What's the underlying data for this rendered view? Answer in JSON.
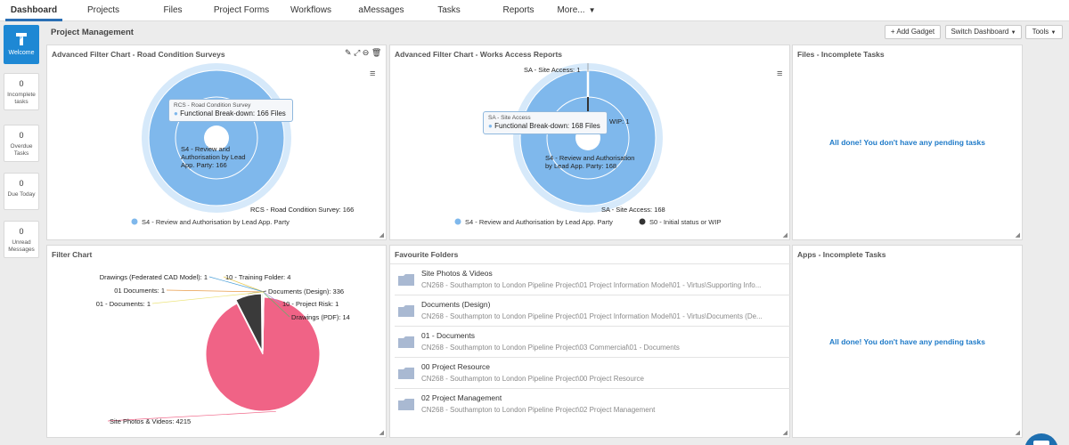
{
  "nav": {
    "items": [
      {
        "label": "Dashboard",
        "active": true
      },
      {
        "label": "Projects"
      },
      {
        "label": "Files"
      },
      {
        "label": "Project Forms"
      },
      {
        "label": "Workflows"
      },
      {
        "label": "aMessages"
      },
      {
        "label": "Tasks"
      },
      {
        "label": "Reports"
      },
      {
        "label": "More..."
      }
    ]
  },
  "sidebar": {
    "welcome_label": "Welcome",
    "cards": [
      {
        "count": "0",
        "label_lines": [
          "Incomplete",
          "tasks"
        ]
      },
      {
        "count": "0",
        "label_lines": [
          "Overdue",
          "Tasks"
        ]
      },
      {
        "count": "0",
        "label_lines": [
          "Due Today"
        ]
      },
      {
        "count": "0",
        "label_lines": [
          "Unread",
          "Messages"
        ]
      }
    ]
  },
  "toolbar": {
    "section_title": "Project Management",
    "add_gadget": "+ Add Gadget",
    "switch_dashboard": "Switch Dashboard",
    "tools": "Tools"
  },
  "panels": {
    "rcs": {
      "title": "Advanced Filter Chart - Road Condition Surveys",
      "tooltip_title": "RCS - Road Condition Survey",
      "tooltip_value": "Functional Break-down: 166 Files",
      "inner_label_lines": [
        "S4 - Review and",
        "Authorisation by Lead",
        "App. Party: 166"
      ],
      "outer_label": "RCS - Road Condition Survey: 166",
      "legend": [
        "S4 - Review and Authorisation by Lead App. Party"
      ]
    },
    "works": {
      "title": "Advanced Filter Chart - Works Access Reports",
      "top_label": "SA - Site Access: 1",
      "tooltip_title": "SA - Site Access",
      "tooltip_value": "Functional Break-down: 168 Files",
      "wip_fragment": "WIP: 1",
      "inner_label_lines": [
        "S4 - Review and Authorisation",
        "by Lead App. Party: 168"
      ],
      "outer_label": "SA - Site Access: 168",
      "legend": [
        "S4 - Review and Authorisation by Lead App. Party",
        "S0 - Initial status or WIP"
      ]
    },
    "files_tasks": {
      "title": "Files - Incomplete Tasks",
      "message": "All done! You don't have any pending tasks"
    },
    "filter": {
      "title": "Filter Chart"
    },
    "favourites": {
      "title": "Favourite Folders",
      "folders": [
        {
          "name": "Site Photos & Videos",
          "path": "CN268 - Southampton to London Pipeline Project\\01 Project Information Model\\01 - Virtus\\Supporting Info..."
        },
        {
          "name": "Documents (Design)",
          "path": "CN268 - Southampton to London Pipeline Project\\01 Project Information Model\\01 - Virtus\\Documents (De..."
        },
        {
          "name": "01 - Documents",
          "path": "CN268 - Southampton to London Pipeline Project\\03 Commercial\\01 - Documents"
        },
        {
          "name": "00 Project Resource",
          "path": "CN268 - Southampton to London Pipeline Project\\00 Project Resource"
        },
        {
          "name": "02 Project Management",
          "path": "CN268 - Southampton to London Pipeline Project\\02 Project Management"
        }
      ]
    },
    "apps_tasks": {
      "title": "Apps - Incomplete Tasks",
      "message": "All done! You don't have any pending tasks"
    }
  },
  "chart_data": [
    {
      "type": "pie",
      "title": "Advanced Filter Chart - Road Condition Surveys",
      "categories": [
        "RCS - Road Condition Survey"
      ],
      "series": [
        {
          "name": "S4 - Review and Authorisation by Lead App. Party",
          "values": [
            166
          ]
        }
      ],
      "colors": [
        "#7fb8ec"
      ]
    },
    {
      "type": "pie",
      "title": "Advanced Filter Chart - Works Access Reports",
      "categories": [
        "SA - Site Access"
      ],
      "series": [
        {
          "name": "S4 - Review and Authorisation by Lead App. Party",
          "values": [
            168
          ]
        },
        {
          "name": "S0 - Initial status or WIP",
          "values": [
            1
          ]
        }
      ],
      "colors": [
        "#7fb8ec",
        "#333333"
      ]
    },
    {
      "type": "pie",
      "title": "Filter Chart",
      "slices": [
        {
          "label": "Site Photos & Videos",
          "value": 4215,
          "color": "#f06386"
        },
        {
          "label": "Documents (Design)",
          "value": 336,
          "color": "#3a3a3a"
        },
        {
          "label": "Drawings (PDF)",
          "value": 14,
          "color": "#5fb36b"
        },
        {
          "label": "10 - Project Risk",
          "value": 1,
          "color": "#a78bd6"
        },
        {
          "label": "10 - Training Folder",
          "value": 4,
          "color": "#e8c74a"
        },
        {
          "label": "Drawings (Federated CAD Model)",
          "value": 1,
          "color": "#4a9fd8"
        },
        {
          "label": "01 Documents",
          "value": 1,
          "color": "#e89c4a"
        },
        {
          "label": "01 - Documents",
          "value": 1,
          "color": "#ece47a"
        }
      ]
    }
  ]
}
